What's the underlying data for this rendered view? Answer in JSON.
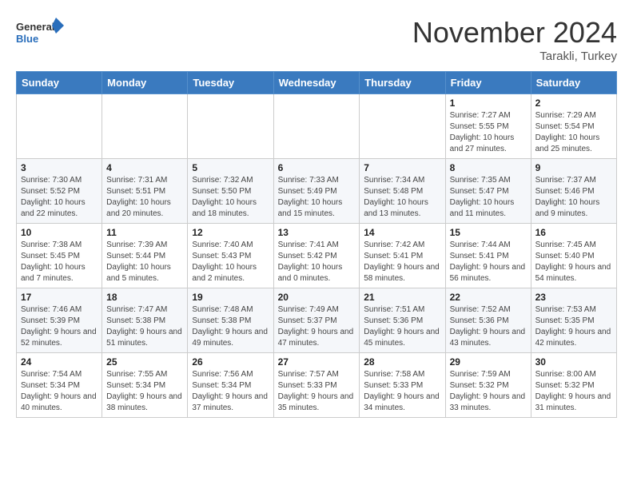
{
  "header": {
    "logo_general": "General",
    "logo_blue": "Blue",
    "title": "November 2024",
    "location": "Tarakli, Turkey"
  },
  "calendar": {
    "days_of_week": [
      "Sunday",
      "Monday",
      "Tuesday",
      "Wednesday",
      "Thursday",
      "Friday",
      "Saturday"
    ],
    "weeks": [
      [
        {
          "day": "",
          "info": ""
        },
        {
          "day": "",
          "info": ""
        },
        {
          "day": "",
          "info": ""
        },
        {
          "day": "",
          "info": ""
        },
        {
          "day": "",
          "info": ""
        },
        {
          "day": "1",
          "info": "Sunrise: 7:27 AM\nSunset: 5:55 PM\nDaylight: 10 hours and 27 minutes."
        },
        {
          "day": "2",
          "info": "Sunrise: 7:29 AM\nSunset: 5:54 PM\nDaylight: 10 hours and 25 minutes."
        }
      ],
      [
        {
          "day": "3",
          "info": "Sunrise: 7:30 AM\nSunset: 5:52 PM\nDaylight: 10 hours and 22 minutes."
        },
        {
          "day": "4",
          "info": "Sunrise: 7:31 AM\nSunset: 5:51 PM\nDaylight: 10 hours and 20 minutes."
        },
        {
          "day": "5",
          "info": "Sunrise: 7:32 AM\nSunset: 5:50 PM\nDaylight: 10 hours and 18 minutes."
        },
        {
          "day": "6",
          "info": "Sunrise: 7:33 AM\nSunset: 5:49 PM\nDaylight: 10 hours and 15 minutes."
        },
        {
          "day": "7",
          "info": "Sunrise: 7:34 AM\nSunset: 5:48 PM\nDaylight: 10 hours and 13 minutes."
        },
        {
          "day": "8",
          "info": "Sunrise: 7:35 AM\nSunset: 5:47 PM\nDaylight: 10 hours and 11 minutes."
        },
        {
          "day": "9",
          "info": "Sunrise: 7:37 AM\nSunset: 5:46 PM\nDaylight: 10 hours and 9 minutes."
        }
      ],
      [
        {
          "day": "10",
          "info": "Sunrise: 7:38 AM\nSunset: 5:45 PM\nDaylight: 10 hours and 7 minutes."
        },
        {
          "day": "11",
          "info": "Sunrise: 7:39 AM\nSunset: 5:44 PM\nDaylight: 10 hours and 5 minutes."
        },
        {
          "day": "12",
          "info": "Sunrise: 7:40 AM\nSunset: 5:43 PM\nDaylight: 10 hours and 2 minutes."
        },
        {
          "day": "13",
          "info": "Sunrise: 7:41 AM\nSunset: 5:42 PM\nDaylight: 10 hours and 0 minutes."
        },
        {
          "day": "14",
          "info": "Sunrise: 7:42 AM\nSunset: 5:41 PM\nDaylight: 9 hours and 58 minutes."
        },
        {
          "day": "15",
          "info": "Sunrise: 7:44 AM\nSunset: 5:41 PM\nDaylight: 9 hours and 56 minutes."
        },
        {
          "day": "16",
          "info": "Sunrise: 7:45 AM\nSunset: 5:40 PM\nDaylight: 9 hours and 54 minutes."
        }
      ],
      [
        {
          "day": "17",
          "info": "Sunrise: 7:46 AM\nSunset: 5:39 PM\nDaylight: 9 hours and 52 minutes."
        },
        {
          "day": "18",
          "info": "Sunrise: 7:47 AM\nSunset: 5:38 PM\nDaylight: 9 hours and 51 minutes."
        },
        {
          "day": "19",
          "info": "Sunrise: 7:48 AM\nSunset: 5:38 PM\nDaylight: 9 hours and 49 minutes."
        },
        {
          "day": "20",
          "info": "Sunrise: 7:49 AM\nSunset: 5:37 PM\nDaylight: 9 hours and 47 minutes."
        },
        {
          "day": "21",
          "info": "Sunrise: 7:51 AM\nSunset: 5:36 PM\nDaylight: 9 hours and 45 minutes."
        },
        {
          "day": "22",
          "info": "Sunrise: 7:52 AM\nSunset: 5:36 PM\nDaylight: 9 hours and 43 minutes."
        },
        {
          "day": "23",
          "info": "Sunrise: 7:53 AM\nSunset: 5:35 PM\nDaylight: 9 hours and 42 minutes."
        }
      ],
      [
        {
          "day": "24",
          "info": "Sunrise: 7:54 AM\nSunset: 5:34 PM\nDaylight: 9 hours and 40 minutes."
        },
        {
          "day": "25",
          "info": "Sunrise: 7:55 AM\nSunset: 5:34 PM\nDaylight: 9 hours and 38 minutes."
        },
        {
          "day": "26",
          "info": "Sunrise: 7:56 AM\nSunset: 5:34 PM\nDaylight: 9 hours and 37 minutes."
        },
        {
          "day": "27",
          "info": "Sunrise: 7:57 AM\nSunset: 5:33 PM\nDaylight: 9 hours and 35 minutes."
        },
        {
          "day": "28",
          "info": "Sunrise: 7:58 AM\nSunset: 5:33 PM\nDaylight: 9 hours and 34 minutes."
        },
        {
          "day": "29",
          "info": "Sunrise: 7:59 AM\nSunset: 5:32 PM\nDaylight: 9 hours and 33 minutes."
        },
        {
          "day": "30",
          "info": "Sunrise: 8:00 AM\nSunset: 5:32 PM\nDaylight: 9 hours and 31 minutes."
        }
      ]
    ]
  }
}
